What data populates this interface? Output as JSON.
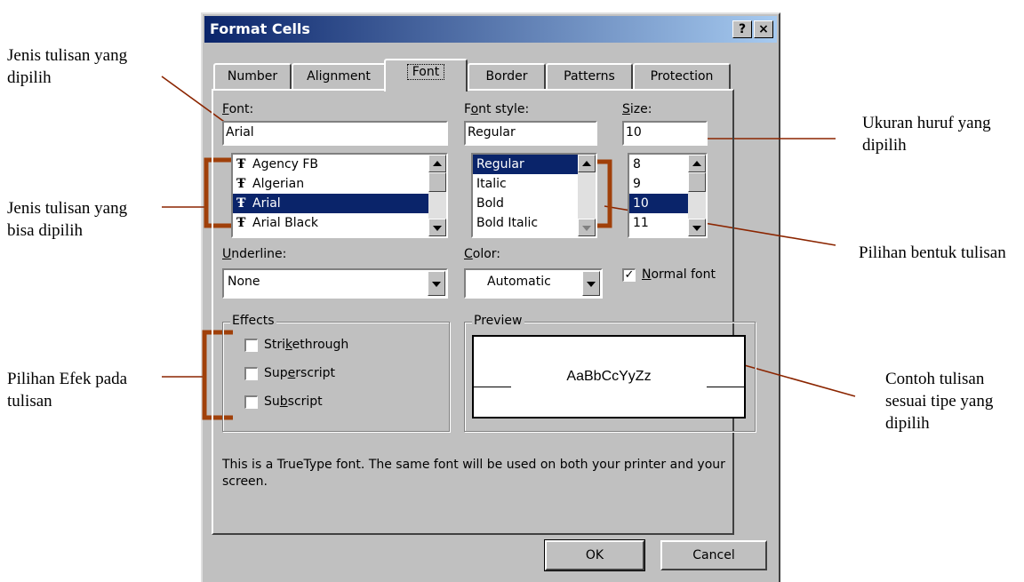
{
  "window": {
    "title": "Format Cells",
    "help_button": "?",
    "close_button": "×"
  },
  "tabs": [
    {
      "label": "Number"
    },
    {
      "label": "Alignment"
    },
    {
      "label": "Font"
    },
    {
      "label": "Border"
    },
    {
      "label": "Patterns"
    },
    {
      "label": "Protection"
    }
  ],
  "font": {
    "label_first": "F",
    "label_rest": "ont:",
    "value": "Arial",
    "list": [
      "Agency FB",
      "Algerian",
      "Arial",
      "Arial Black"
    ],
    "selected": "Arial"
  },
  "font_style": {
    "label_pre": "F",
    "label_u": "o",
    "label_post": "nt style:",
    "value": "Regular",
    "list": [
      "Regular",
      "Italic",
      "Bold",
      "Bold Italic"
    ],
    "selected": "Regular"
  },
  "size": {
    "label_u": "S",
    "label_post": "ize:",
    "value": "10",
    "list": [
      "8",
      "9",
      "10",
      "11"
    ],
    "selected": "10"
  },
  "underline": {
    "label_u": "U",
    "label_post": "nderline:",
    "value": "None"
  },
  "color": {
    "label_u": "C",
    "label_post": "olor:",
    "value": "Automatic"
  },
  "normal_font": {
    "label_u": "N",
    "label_post": "ormal font",
    "checked": true
  },
  "effects": {
    "title": "Effects",
    "items": [
      {
        "pre": "Stri",
        "u": "k",
        "post": "ethrough",
        "checked": false
      },
      {
        "pre": "Sup",
        "u": "e",
        "post": "rscript",
        "checked": false
      },
      {
        "pre": "Su",
        "u": "b",
        "post": "script",
        "checked": false
      }
    ]
  },
  "preview": {
    "title": "Preview",
    "sample": "AaBbCcYyZz"
  },
  "info_text": "This is a TrueType font.  The same font will be used on both your printer and your screen.",
  "buttons": {
    "ok": "OK",
    "cancel": "Cancel"
  },
  "annotations": {
    "left": [
      "Jenis tulisan yang dipilih",
      "Jenis tulisan yang bisa dipilih",
      "Pilihan Efek pada tulisan"
    ],
    "right": [
      "Ukuran huruf yang dipilih",
      "Pilihan bentuk tulisan",
      "Contoh tulisan sesuai tipe yang dipilih"
    ]
  },
  "colors": {
    "title_bar": "#0a246a",
    "dialog_bg": "#c0c0c0",
    "selection": "#0a246a",
    "annotation_line": "#8b2500",
    "bracket": "#a0400a"
  }
}
